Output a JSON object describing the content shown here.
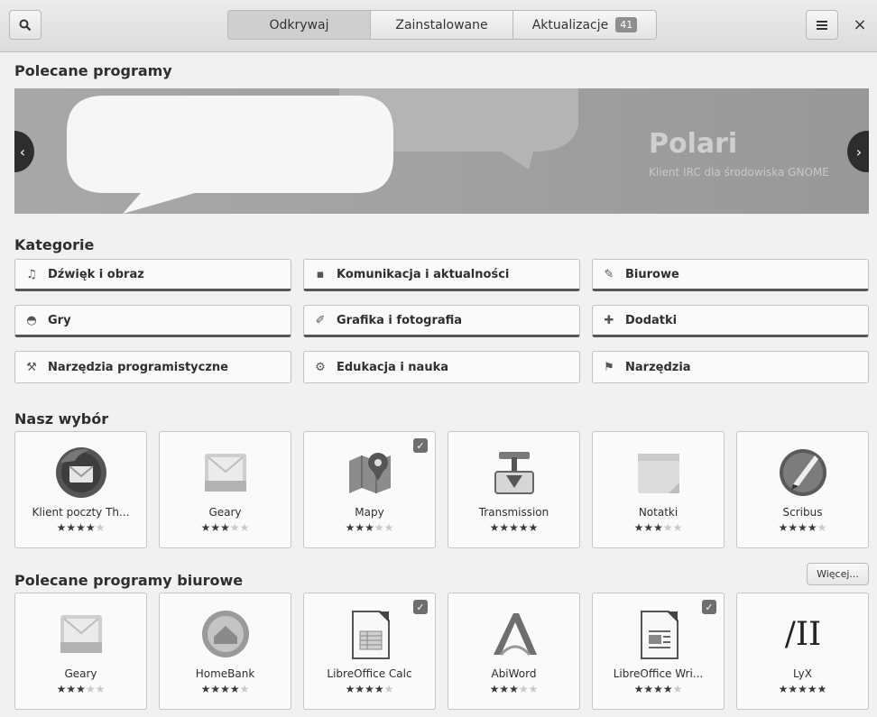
{
  "header": {
    "tabs": [
      {
        "label": "Odkrywaj"
      },
      {
        "label": "Zainstalowane"
      },
      {
        "label": "Aktualizacje",
        "badge": "41"
      }
    ]
  },
  "featured": {
    "title": "Polecane programy",
    "app_name": "Polari",
    "app_desc": "Klient IRC dla środowiska GNOME"
  },
  "categories": {
    "title": "Kategorie",
    "items": [
      {
        "label": "Dźwięk i obraz",
        "icon": "music-icon"
      },
      {
        "label": "Komunikacja i aktualności",
        "icon": "chat-icon"
      },
      {
        "label": "Biurowe",
        "icon": "edit-icon"
      },
      {
        "label": "Gry",
        "icon": "gamepad-icon"
      },
      {
        "label": "Grafika i fotografia",
        "icon": "brush-icon"
      },
      {
        "label": "Dodatki",
        "icon": "puzzle-icon"
      },
      {
        "label": "Narzędzia programistyczne",
        "icon": "build-icon"
      },
      {
        "label": "Edukacja i nauka",
        "icon": "science-icon"
      },
      {
        "label": "Narzędzia",
        "icon": "utilities-icon"
      }
    ]
  },
  "picks": {
    "title": "Nasz wybór",
    "apps": [
      {
        "name": "Klient poczty Th...",
        "rating": 4,
        "installed": false
      },
      {
        "name": "Geary",
        "rating": 3,
        "installed": false
      },
      {
        "name": "Mapy",
        "rating": 3,
        "installed": true
      },
      {
        "name": "Transmission",
        "rating": 5,
        "installed": false
      },
      {
        "name": "Notatki",
        "rating": 3,
        "installed": false
      },
      {
        "name": "Scribus",
        "rating": 4,
        "installed": false
      }
    ]
  },
  "office": {
    "title": "Polecane programy biurowe",
    "more_label": "Więcej...",
    "apps": [
      {
        "name": "Geary",
        "rating": 3,
        "installed": false
      },
      {
        "name": "HomeBank",
        "rating": 4,
        "installed": false
      },
      {
        "name": "LibreOffice Calc",
        "rating": 4,
        "installed": true
      },
      {
        "name": "AbiWord",
        "rating": 3,
        "installed": false
      },
      {
        "name": "LibreOffice Wri...",
        "rating": 4,
        "installed": true
      },
      {
        "name": "LyX",
        "rating": 5,
        "installed": false,
        "icon_text": "/II"
      }
    ]
  }
}
